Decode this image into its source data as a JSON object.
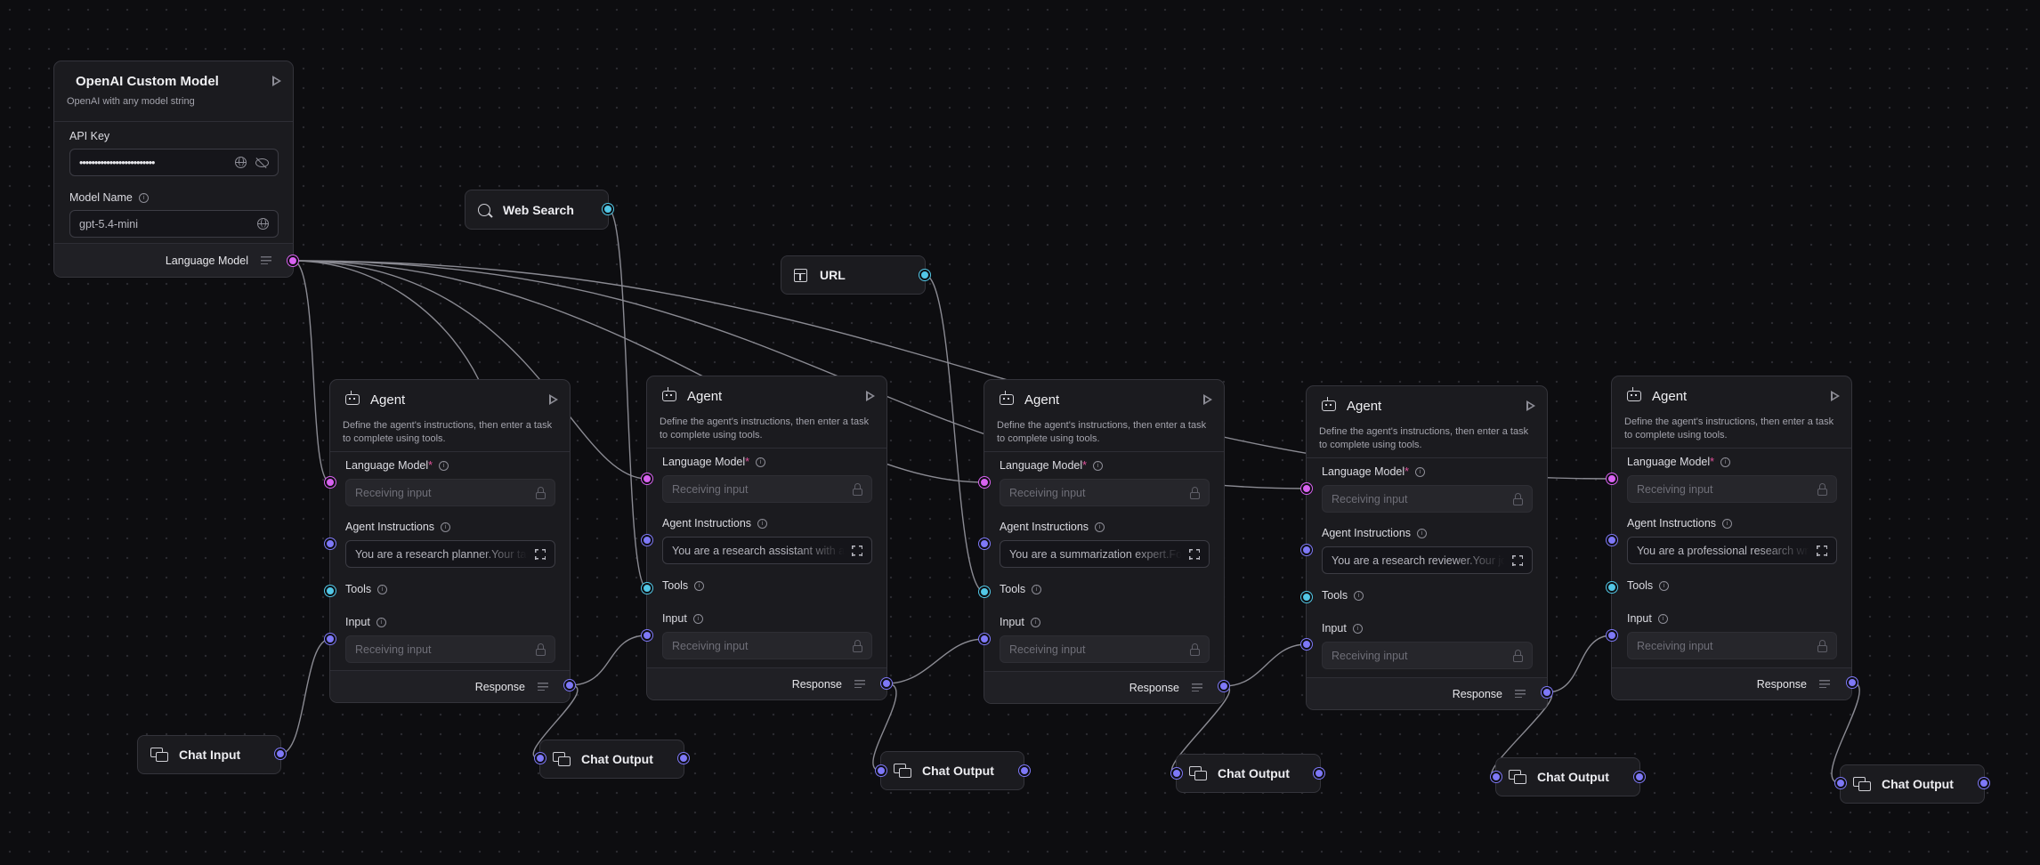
{
  "colors": {
    "canvas_bg": "#0d0d10",
    "node_bg": "#1b1b1f",
    "handle_model": "#d862f0",
    "handle_message": "#7e78f7",
    "handle_tool": "#52c7e6",
    "edge": "#8a8a92"
  },
  "model_node": {
    "title": "OpenAI Custom Model",
    "description": "OpenAI with any model string",
    "api_key_label": "API Key",
    "api_key_value": "•••••••••••••••••••••••••",
    "model_name_label": "Model Name",
    "model_name_value": "gpt-5.4-mini",
    "output_label": "Language Model",
    "icons": [
      "play-icon",
      "globe-icon",
      "eye-off-icon",
      "info-icon",
      "menu-lines-icon"
    ]
  },
  "web_search": {
    "label": "Web Search",
    "icon": "search-icon"
  },
  "url_node": {
    "label": "URL",
    "icon": "layout-icon"
  },
  "agent_common": {
    "title": "Agent",
    "description": "Define the agent's instructions, then enter a task to complete using tools.",
    "language_model_label": "Language Model",
    "required_mark": "*",
    "instructions_label": "Agent Instructions",
    "tools_label": "Tools",
    "input_label": "Input",
    "receiving": "Receiving input",
    "response_label": "Response"
  },
  "agents": [
    {
      "instructions": "You are a research planner.Your task is to"
    },
    {
      "instructions": "You are a research assistant with access"
    },
    {
      "instructions": "You are a summarization expert.Focus on"
    },
    {
      "instructions": "You are a research reviewer.Your job is to"
    },
    {
      "instructions": "You are a professional research writer"
    }
  ],
  "chat_input": {
    "label": "Chat Input",
    "icon": "chat-icon"
  },
  "chat_outputs": [
    {
      "label": "Chat Output"
    },
    {
      "label": "Chat Output"
    },
    {
      "label": "Chat Output"
    },
    {
      "label": "Chat Output"
    },
    {
      "label": "Chat Output"
    }
  ]
}
